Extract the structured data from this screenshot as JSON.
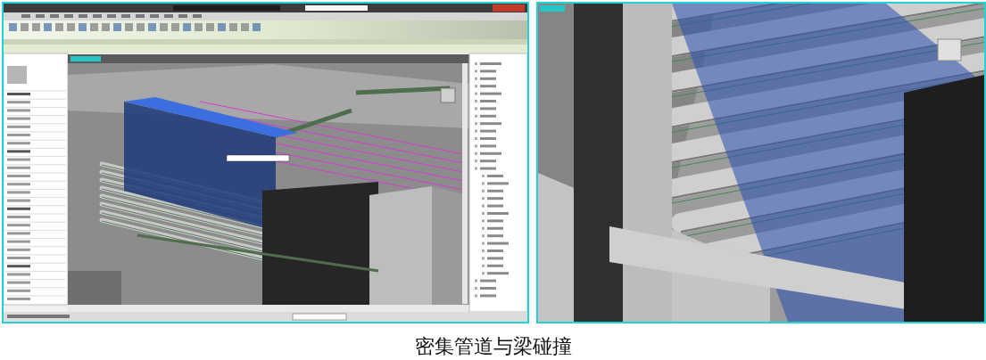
{
  "figures": [
    {
      "kind": "app-screenshot"
    },
    {
      "kind": "closeup-render"
    }
  ],
  "caption": "密集管道与梁碰撞"
}
